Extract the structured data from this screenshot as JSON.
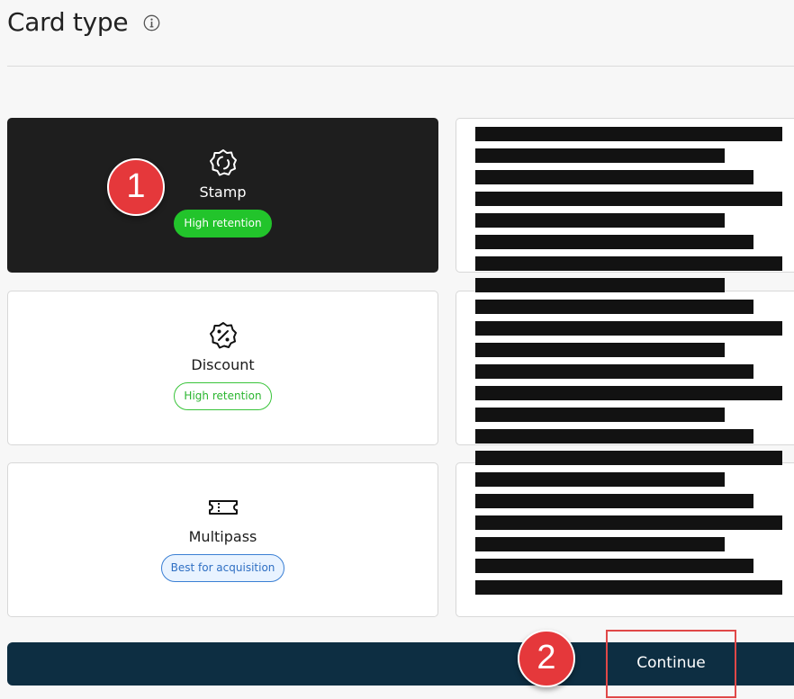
{
  "header": {
    "title": "Card type",
    "info_icon": "info-circle-icon"
  },
  "cards": [
    {
      "label": "Stamp",
      "badge": "High retention",
      "icon": "stamp-badge-icon",
      "selected": true
    },
    {
      "label": "Discount",
      "badge": "High retention",
      "icon": "percent-badge-icon",
      "selected": false
    },
    {
      "label": "Multipass",
      "badge": "Best for acquisition",
      "icon": "ticket-icon",
      "selected": false
    }
  ],
  "actions": {
    "continue_label": "Continue"
  },
  "steps": {
    "one": "1",
    "two": "2"
  },
  "colors": {
    "selected_card": "#1e1e1e",
    "badge_green": "#22c42b",
    "badge_blue": "#3a7fd4",
    "continue_bar": "#0d2e42",
    "step_marker": "#e5383b",
    "highlight_border": "#e04848"
  }
}
